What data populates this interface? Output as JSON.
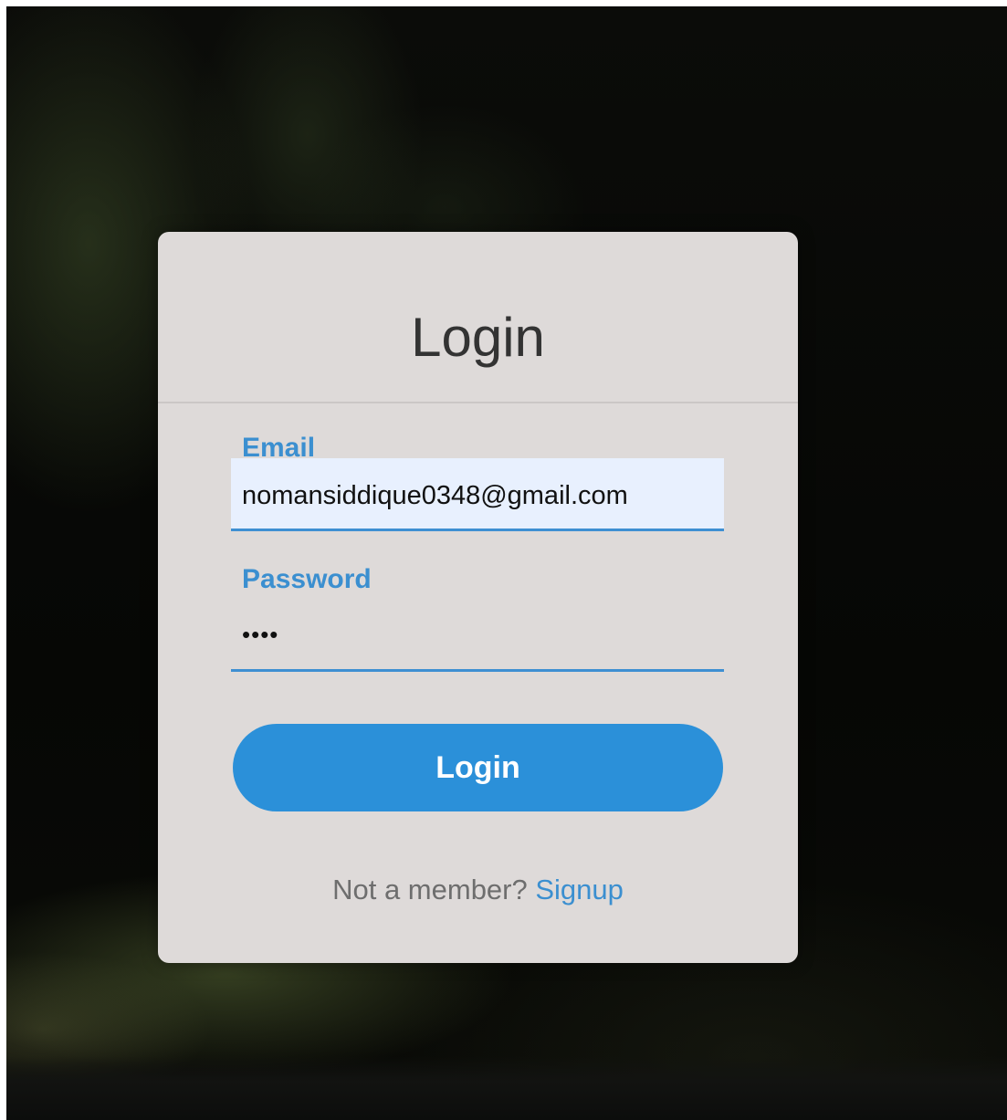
{
  "login_form": {
    "title": "Login",
    "email": {
      "label": "Email",
      "value": "nomansiddique0348@gmail.com"
    },
    "password": {
      "label": "Password",
      "value": "••••"
    },
    "submit_label": "Login",
    "signup_prompt": "Not a member?",
    "signup_link": "Signup"
  },
  "colors": {
    "accent": "#2b90d9",
    "label": "#3b8fd0",
    "card_background": "#dedad9",
    "page_background": "#060705",
    "autofill_background": "#e8f0fe"
  }
}
